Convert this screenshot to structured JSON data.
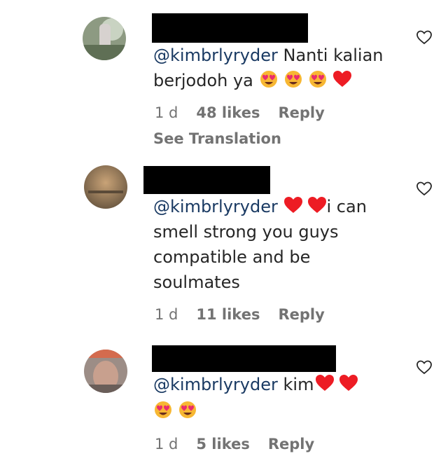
{
  "comments": [
    {
      "mention": "@kimbrlyryder",
      "text_lines": [
        "Nanti kalian",
        "berjodoh ya"
      ],
      "emojis": [
        "heart-eyes",
        "heart-eyes",
        "heart-eyes",
        "red-heart"
      ],
      "time": "1 d",
      "likes": "48 likes",
      "reply": "Reply",
      "translation": "See Translation"
    },
    {
      "mention": "@kimbrlyryder",
      "inline_emojis": [
        "red-heart",
        "red-heart"
      ],
      "first_line_tail": "i can",
      "text_lines": [
        "smell strong you guys",
        "compatible and be",
        "soulmates"
      ],
      "time": "1 d",
      "likes": "11 likes",
      "reply": "Reply"
    },
    {
      "mention": "@kimbrlyryder",
      "first_line_tail": "kim",
      "inline_emojis": [
        "red-heart",
        "red-heart"
      ],
      "emojis_line2": [
        "heart-eyes",
        "heart-eyes"
      ],
      "time": "1 d",
      "likes": "5 likes",
      "reply": "Reply"
    }
  ],
  "icons": {
    "like": "heart-outline-icon",
    "heart_color": "#ed1c24",
    "emoji_color": "#f7b733"
  }
}
